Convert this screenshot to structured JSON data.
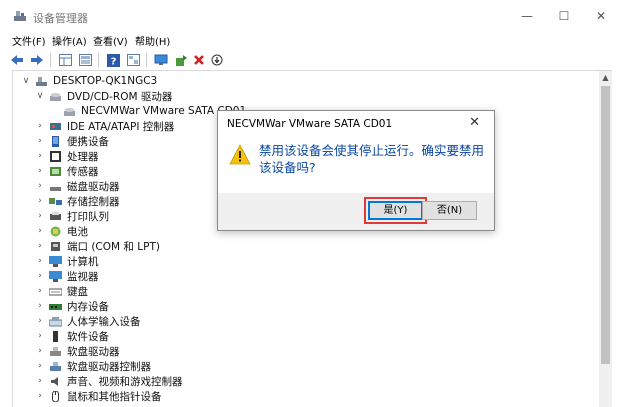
{
  "window": {
    "title": "设备管理器",
    "minimize_glyph": "—",
    "maximize_glyph": "☐",
    "close_glyph": "✕"
  },
  "menu": [
    "文件(F)",
    "操作(A)",
    "查看(V)",
    "帮助(H)"
  ],
  "toolbar_icons": [
    "back-arrow-icon",
    "forward-arrow-icon",
    "properties-grid-icon",
    "device-list-icon",
    "help-icon",
    "device-view-icon",
    "monitor-icon",
    "update-driver-icon",
    "uninstall-x-icon",
    "scan-hardware-icon"
  ],
  "tree": {
    "root": "DESKTOP-QK1NGC3",
    "items": [
      {
        "label": "DVD/CD-ROM 驱动器",
        "expanded": true,
        "icon": "dvd-drive-icon"
      },
      {
        "label": "NECVMWar VMware SATA CD01",
        "child": true,
        "icon": "cd-device-icon"
      },
      {
        "label": "IDE ATA/ATAPI 控制器",
        "icon": "ide-controller-icon"
      },
      {
        "label": "便携设备",
        "icon": "portable-device-icon"
      },
      {
        "label": "处理器",
        "icon": "processor-icon"
      },
      {
        "label": "传感器",
        "icon": "sensor-icon"
      },
      {
        "label": "磁盘驱动器",
        "icon": "disk-drive-icon"
      },
      {
        "label": "存储控制器",
        "icon": "storage-controller-icon"
      },
      {
        "label": "打印队列",
        "icon": "print-queue-icon"
      },
      {
        "label": "电池",
        "icon": "battery-icon"
      },
      {
        "label": "端口 (COM 和 LPT)",
        "icon": "port-icon"
      },
      {
        "label": "计算机",
        "icon": "computer-icon"
      },
      {
        "label": "监视器",
        "icon": "monitor-icon"
      },
      {
        "label": "键盘",
        "icon": "keyboard-icon"
      },
      {
        "label": "内存设备",
        "icon": "memory-icon"
      },
      {
        "label": "人体学输入设备",
        "icon": "hid-icon"
      },
      {
        "label": "软件设备",
        "icon": "software-device-icon"
      },
      {
        "label": "软盘驱动器",
        "icon": "floppy-drive-icon"
      },
      {
        "label": "软盘驱动器控制器",
        "icon": "floppy-controller-icon"
      },
      {
        "label": "声音、视频和游戏控制器",
        "icon": "sound-icon"
      },
      {
        "label": "鼠标和其他指针设备",
        "icon": "mouse-icon"
      }
    ]
  },
  "dialog": {
    "title": "NECVMWar VMware SATA CD01",
    "close_glyph": "✕",
    "message": "禁用该设备会使其停止运行。确实要禁用该设备吗?",
    "yes_label": "是(Y)",
    "no_label": "否(N)",
    "highlight_color": "#e03a3a"
  }
}
